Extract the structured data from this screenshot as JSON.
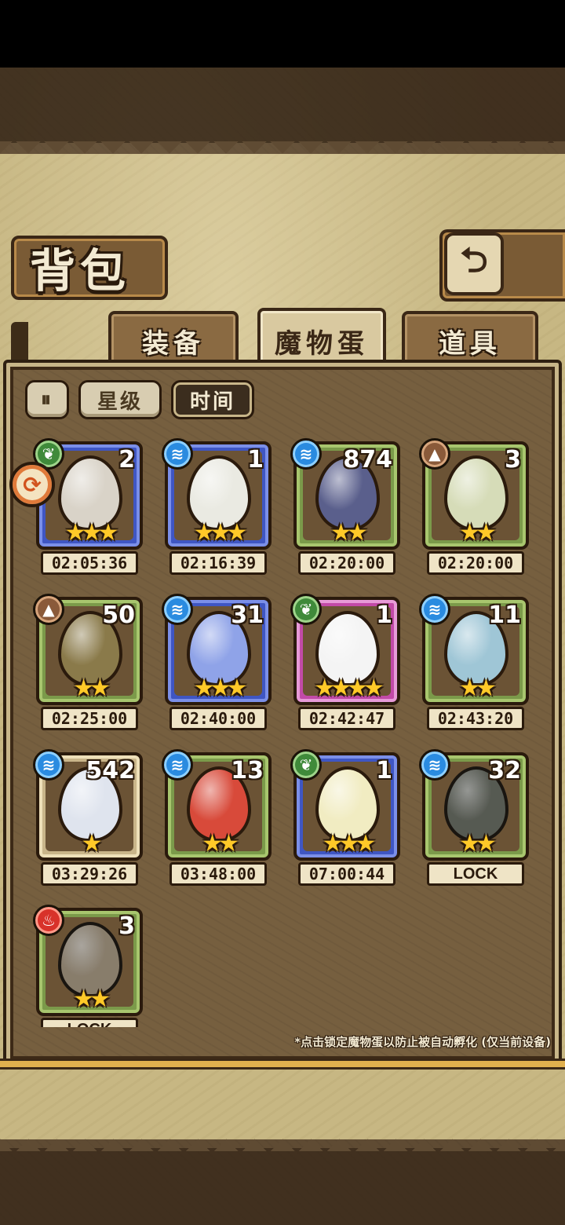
{
  "page_title": "背包",
  "tabs": [
    {
      "label": "装备",
      "active": false
    },
    {
      "label": "魔物蛋",
      "active": true
    },
    {
      "label": "道具",
      "active": false
    }
  ],
  "sort": {
    "toggle_icon": "sort-order-icon",
    "buttons": [
      {
        "label": "星级",
        "active": false
      },
      {
        "label": "时间",
        "active": true
      }
    ]
  },
  "eggs": [
    {
      "element": "nature",
      "rarity": "blue",
      "count": "2",
      "stars": 3,
      "time": "02:05:36",
      "color": "#d9d3c8"
    },
    {
      "element": "water",
      "rarity": "blue",
      "count": "1",
      "stars": 3,
      "time": "02:16:39",
      "color": "#eaeae2"
    },
    {
      "element": "water",
      "rarity": "green",
      "count": "874",
      "stars": 2,
      "time": "02:20:00",
      "color": "#5a5f8c"
    },
    {
      "element": "earth",
      "rarity": "green",
      "count": "3",
      "stars": 2,
      "time": "02:20:00",
      "color": "#d6dcb8"
    },
    {
      "element": "earth",
      "rarity": "green",
      "count": "50",
      "stars": 2,
      "time": "02:25:00",
      "color": "#8a7a4a"
    },
    {
      "element": "water",
      "rarity": "blue",
      "count": "31",
      "stars": 3,
      "time": "02:40:00",
      "color": "#8fa3e8"
    },
    {
      "element": "nature",
      "rarity": "pink",
      "count": "1",
      "stars": 4,
      "time": "02:42:47",
      "color": "#f4f4f4"
    },
    {
      "element": "water",
      "rarity": "green",
      "count": "11",
      "stars": 2,
      "time": "02:43:20",
      "color": "#9fc6d6"
    },
    {
      "element": "water",
      "rarity": "tan",
      "count": "542",
      "stars": 1,
      "time": "03:29:26",
      "color": "#dfe4ee"
    },
    {
      "element": "water",
      "rarity": "green",
      "count": "13",
      "stars": 2,
      "time": "03:48:00",
      "color": "#d84a3a"
    },
    {
      "element": "nature",
      "rarity": "blue",
      "count": "1",
      "stars": 3,
      "time": "07:00:44",
      "color": "#f1ecc2"
    },
    {
      "element": "water",
      "rarity": "green",
      "count": "32",
      "stars": 2,
      "time": "LOCK",
      "color": "#6e7a60",
      "locked": true
    },
    {
      "element": "fire",
      "rarity": "green",
      "count": "3",
      "stars": 2,
      "time": "LOCK",
      "color": "#c9a46a",
      "locked": true
    }
  ],
  "element_icons": {
    "water": "≋",
    "nature": "❦",
    "earth": "▲",
    "fire": "♨"
  },
  "footnote": "*点击锁定魔物蛋以防止被自动孵化 (仅当前设备)"
}
